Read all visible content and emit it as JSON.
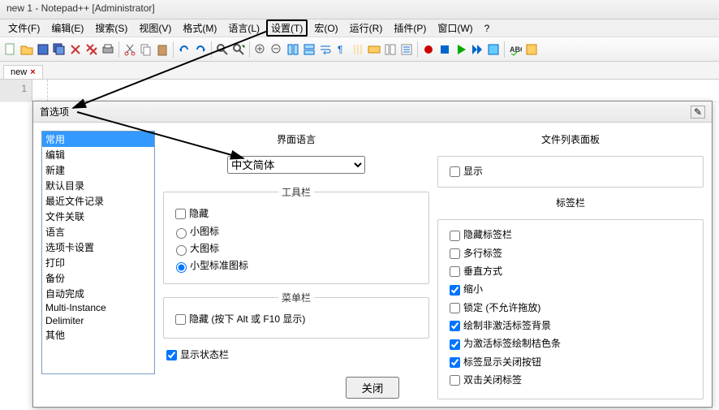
{
  "window": {
    "title": "new 1 - Notepad++ [Administrator]"
  },
  "menubar": {
    "file": "文件(F)",
    "edit": "编辑(E)",
    "search": "搜索(S)",
    "view": "视图(V)",
    "format": "格式(M)",
    "language": "语言(L)",
    "settings": "设置(T)",
    "macro": "宏(O)",
    "run": "运行(R)",
    "plugins": "插件(P)",
    "window": "窗口(W)",
    "help": "?"
  },
  "tab": {
    "name": "new",
    "close": "×"
  },
  "gutter": {
    "line1": "1"
  },
  "dialog": {
    "title": "首选项",
    "pin": "✎",
    "categories": [
      "常用",
      "编辑",
      "新建",
      "默认目录",
      "最近文件记录",
      "文件关联",
      "语言",
      "选项卡设置",
      "打印",
      "备份",
      "自动完成",
      "Multi-Instance",
      "Delimiter",
      "其他"
    ],
    "selected_index": 0,
    "ui_lang": {
      "heading": "界面语言",
      "value": "中文简体"
    },
    "toolbar_group": {
      "legend": "工具栏",
      "hide": "隐藏",
      "small": "小图标",
      "big": "大图标",
      "standard": "小型标准图标"
    },
    "menubar_group": {
      "legend": "菜单栏",
      "hide": "隐藏 (按下 Alt 或 F10 显示)"
    },
    "statusbar": "显示状态栏",
    "filelist": {
      "heading": "文件列表面板",
      "show": "显示"
    },
    "tabgroup": {
      "legend": "标签栏",
      "hide": "隐藏标签栏",
      "multiline": "多行标签",
      "vertical": "垂直方式",
      "shrink": "缩小",
      "lock": "锁定 (不允许拖放)",
      "drawbg": "绘制非激活标签背景",
      "orange": "为激活标签绘制桔色条",
      "showclose": "标签显示关闭按钮",
      "dblclose": "双击关闭标签"
    },
    "close_btn": "关闭"
  }
}
